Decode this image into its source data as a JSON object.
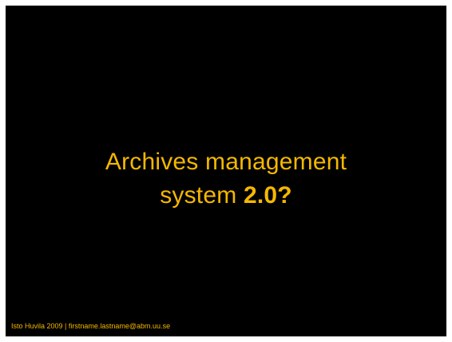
{
  "slide": {
    "title_line1": "Archives management",
    "title_line2_prefix": "system",
    "title_line2_version": "2.0?",
    "footer": "Isto Huvila 2009 | firstname.lastname@abm.uu.se"
  },
  "colors": {
    "background": "#000000",
    "accent": "#f5b800",
    "frame": "#ffffff"
  }
}
